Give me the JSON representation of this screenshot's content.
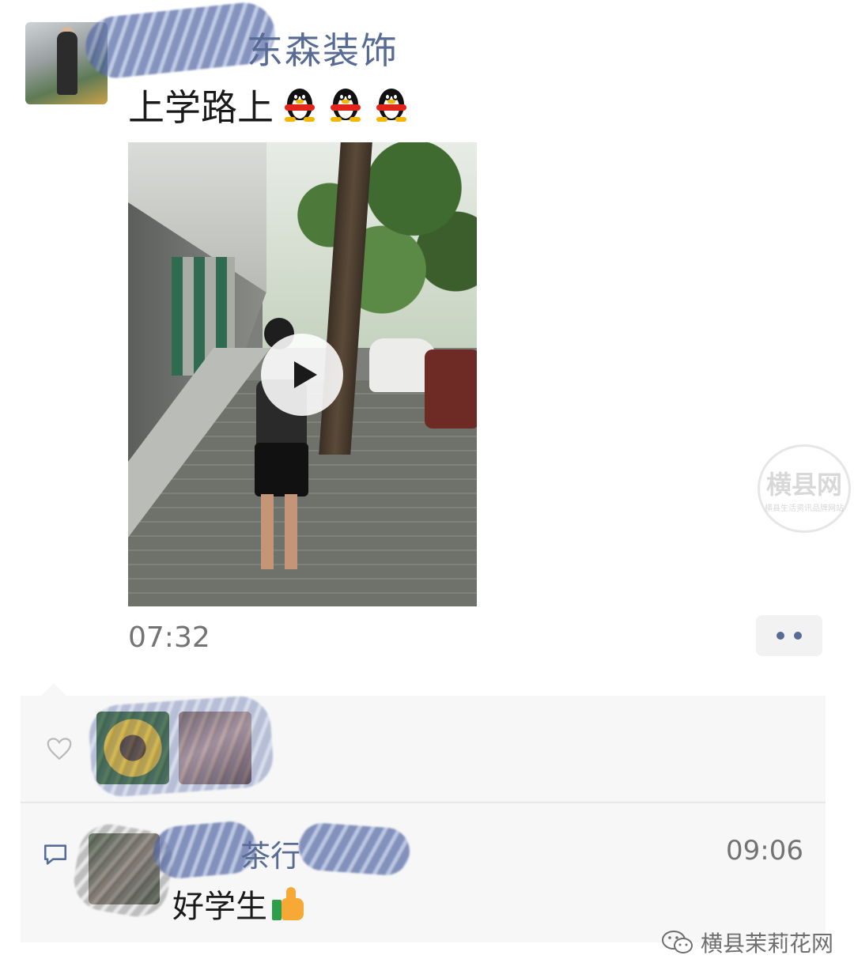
{
  "post": {
    "author_name_visible": "东森装饰",
    "text": "上学路上",
    "emoji_icons": [
      "qq-penguin-icon",
      "qq-penguin-icon",
      "qq-penguin-icon"
    ],
    "time": "07:32",
    "video": {
      "play_icon": "play-icon"
    }
  },
  "interactions": {
    "likes_icon": "heart-icon",
    "comments": [
      {
        "name_visible": "茶行",
        "time": "09:06",
        "text": "好学生",
        "emoji_icon": "thumbs-up-icon"
      }
    ]
  },
  "watermark": {
    "seal_text": "横县网",
    "seal_subtext": "横县生活资讯品牌网站",
    "footer_text": "横县茉莉花网",
    "footer_icon": "wechat-icon"
  },
  "colors": {
    "link": "#576b95",
    "panel": "#f7f7f7",
    "muted": "#737373"
  }
}
